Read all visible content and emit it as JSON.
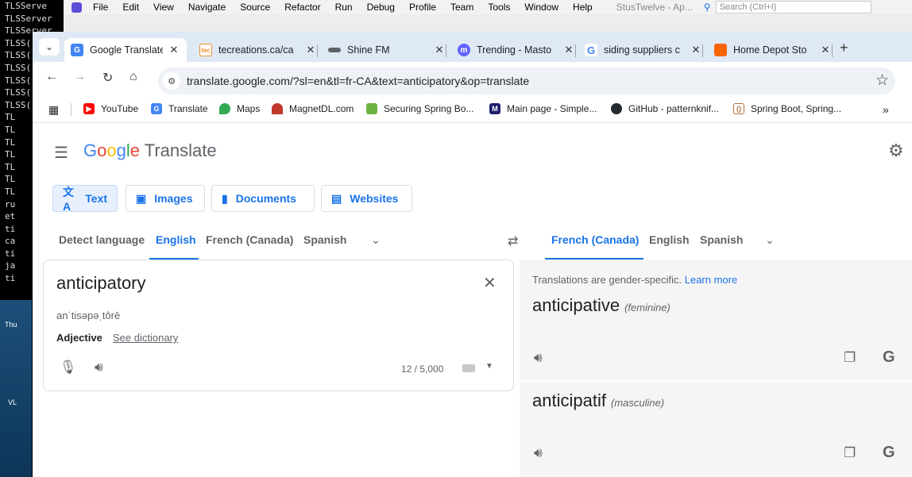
{
  "terminal": {
    "lines": [
      "TLSServe",
      "TLSServer",
      "TLSServer",
      "TLSS(",
      "TLSS(",
      "TLSS(",
      "TLSS(",
      "TLSS(",
      "TLSS(",
      "TL",
      "TL",
      "TL",
      "TL",
      "TL",
      "TL",
      "TL",
      "ru",
      "et",
      "",
      "ti",
      "ca",
      "ti",
      "ja",
      "ti"
    ]
  },
  "desktop": {
    "labels": [
      "Thu",
      "VL"
    ]
  },
  "ide": {
    "menu": [
      "File",
      "Edit",
      "View",
      "Navigate",
      "Source",
      "Refactor",
      "Run",
      "Debug",
      "Profile",
      "Team",
      "Tools",
      "Window",
      "Help"
    ],
    "title": "StusTwelve - Ap...",
    "search_placeholder": "Search (Ctrl+I)"
  },
  "browser": {
    "tabs": [
      {
        "label": "Google Translate",
        "icon": "google-translate-icon",
        "color": "#4285f4"
      },
      {
        "label": "tecreations.ca/ca",
        "icon": "tec-icon",
        "color": "#f28c28"
      },
      {
        "label": "Shine FM",
        "icon": "shine-fm-icon",
        "color": "#5f6368"
      },
      {
        "label": "Trending - Masto",
        "icon": "mastodon-icon",
        "color": "#6364ff"
      },
      {
        "label": "siding suppliers c",
        "icon": "google-icon",
        "color": "#4285f4"
      },
      {
        "label": "Home Depot Sto",
        "icon": "home-depot-icon",
        "color": "#f96302"
      }
    ],
    "url": "translate.google.com/?sl=en&tl=fr-CA&text=anticipatory&op=translate",
    "bookmarks": [
      {
        "label": "YouTube",
        "icon": "youtube-icon",
        "color": "#ff0000"
      },
      {
        "label": "Translate",
        "icon": "google-translate-icon",
        "color": "#4285f4"
      },
      {
        "label": "Maps",
        "icon": "maps-icon",
        "color": "#34a853"
      },
      {
        "label": "MagnetDL.com",
        "icon": "magnet-icon",
        "color": "#c0392b"
      },
      {
        "label": "Securing Spring Bo...",
        "icon": "spring-icon",
        "color": "#6db33f"
      },
      {
        "label": "Main page - Simple...",
        "icon": "wikipedia-icon",
        "color": "#1e1e6e"
      },
      {
        "label": "GitHub - patternknif...",
        "icon": "github-icon",
        "color": "#24292e"
      },
      {
        "label": "Spring Boot, Spring...",
        "icon": "bookmark-icon",
        "color": "#b0733b"
      }
    ]
  },
  "translate": {
    "logo_google": "Google",
    "logo_product": "Translate",
    "modes": [
      "Text",
      "Images",
      "Documents",
      "Websites"
    ],
    "source_langs": [
      "Detect language",
      "English",
      "French (Canada)",
      "Spanish"
    ],
    "target_langs": [
      "French (Canada)",
      "English",
      "Spanish"
    ],
    "source_text": "anticipatory",
    "phonetic": "anˈtisəpəˌtôrē",
    "part_of_speech": "Adjective",
    "see_dictionary": "See dictionary",
    "char_count": "12 / 5,000",
    "gender_note": "Translations are gender-specific.",
    "learn_more": "Learn more",
    "translations": [
      {
        "word": "anticipative",
        "gender": "(feminine)"
      },
      {
        "word": "anticipatif",
        "gender": "(masculine)"
      }
    ]
  }
}
